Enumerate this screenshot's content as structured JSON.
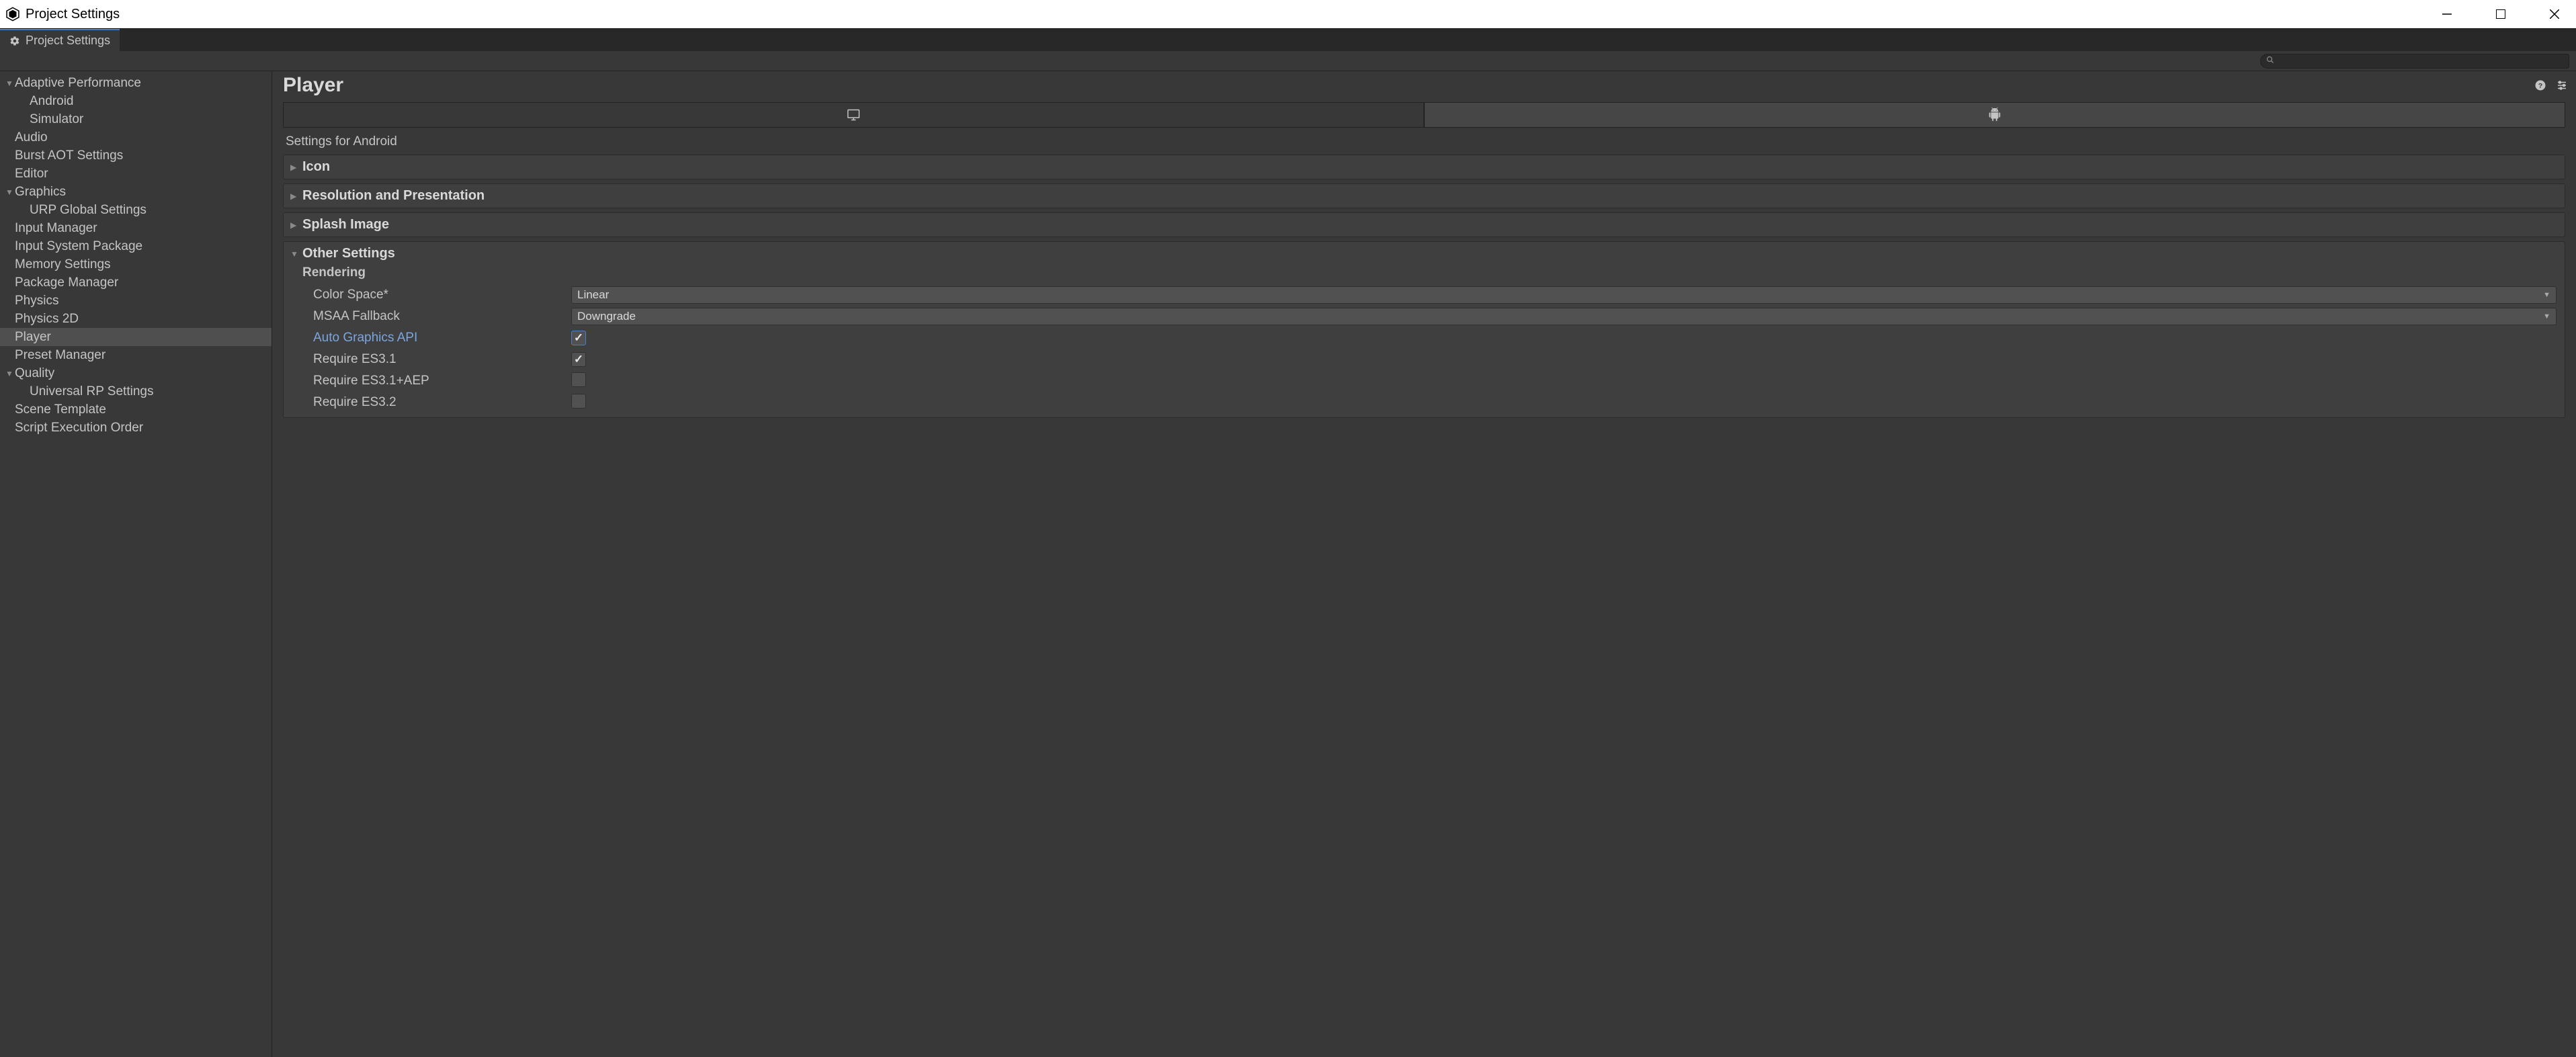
{
  "window": {
    "title": "Project Settings"
  },
  "tab": {
    "label": "Project Settings"
  },
  "search": {
    "placeholder": ""
  },
  "sidebar": {
    "items": [
      {
        "label": "Adaptive Performance",
        "indent": 0,
        "expandable": true,
        "expanded": true,
        "selected": false
      },
      {
        "label": "Android",
        "indent": 1,
        "expandable": false,
        "selected": false
      },
      {
        "label": "Simulator",
        "indent": 1,
        "expandable": false,
        "selected": false
      },
      {
        "label": "Audio",
        "indent": 0,
        "expandable": false,
        "selected": false
      },
      {
        "label": "Burst AOT Settings",
        "indent": 0,
        "expandable": false,
        "selected": false
      },
      {
        "label": "Editor",
        "indent": 0,
        "expandable": false,
        "selected": false
      },
      {
        "label": "Graphics",
        "indent": 0,
        "expandable": true,
        "expanded": true,
        "selected": false
      },
      {
        "label": "URP Global Settings",
        "indent": 1,
        "expandable": false,
        "selected": false
      },
      {
        "label": "Input Manager",
        "indent": 0,
        "expandable": false,
        "selected": false
      },
      {
        "label": "Input System Package",
        "indent": 0,
        "expandable": false,
        "selected": false
      },
      {
        "label": "Memory Settings",
        "indent": 0,
        "expandable": false,
        "selected": false
      },
      {
        "label": "Package Manager",
        "indent": 0,
        "expandable": false,
        "selected": false
      },
      {
        "label": "Physics",
        "indent": 0,
        "expandable": false,
        "selected": false
      },
      {
        "label": "Physics 2D",
        "indent": 0,
        "expandable": false,
        "selected": false
      },
      {
        "label": "Player",
        "indent": 0,
        "expandable": false,
        "selected": true
      },
      {
        "label": "Preset Manager",
        "indent": 0,
        "expandable": false,
        "selected": false
      },
      {
        "label": "Quality",
        "indent": 0,
        "expandable": true,
        "expanded": true,
        "selected": false
      },
      {
        "label": "Universal RP Settings",
        "indent": 1,
        "expandable": false,
        "selected": false
      },
      {
        "label": "Scene Template",
        "indent": 0,
        "expandable": false,
        "selected": false
      },
      {
        "label": "Script Execution Order",
        "indent": 0,
        "expandable": false,
        "selected": false
      }
    ]
  },
  "content": {
    "title": "Player",
    "platform_subheading": "Settings for Android",
    "platform_tabs": [
      {
        "name": "desktop",
        "active": false
      },
      {
        "name": "android",
        "active": true
      }
    ],
    "foldouts": [
      {
        "title": "Icon",
        "expanded": false
      },
      {
        "title": "Resolution and Presentation",
        "expanded": false
      },
      {
        "title": "Splash Image",
        "expanded": false
      }
    ],
    "other_settings": {
      "title": "Other Settings",
      "expanded": true,
      "rendering_label": "Rendering",
      "fields": {
        "color_space": {
          "label": "Color Space*",
          "value": "Linear",
          "type": "dropdown"
        },
        "msaa_fallback": {
          "label": "MSAA Fallback",
          "value": "Downgrade",
          "type": "dropdown"
        },
        "auto_graphics_api": {
          "label": "Auto Graphics API",
          "checked": true,
          "type": "checkbox",
          "highlight": true
        },
        "require_es31": {
          "label": "Require ES3.1",
          "checked": true,
          "type": "checkbox"
        },
        "require_es31aep": {
          "label": "Require ES3.1+AEP",
          "checked": false,
          "type": "checkbox"
        },
        "require_es32": {
          "label": "Require ES3.2",
          "checked": false,
          "type": "checkbox"
        }
      }
    }
  }
}
